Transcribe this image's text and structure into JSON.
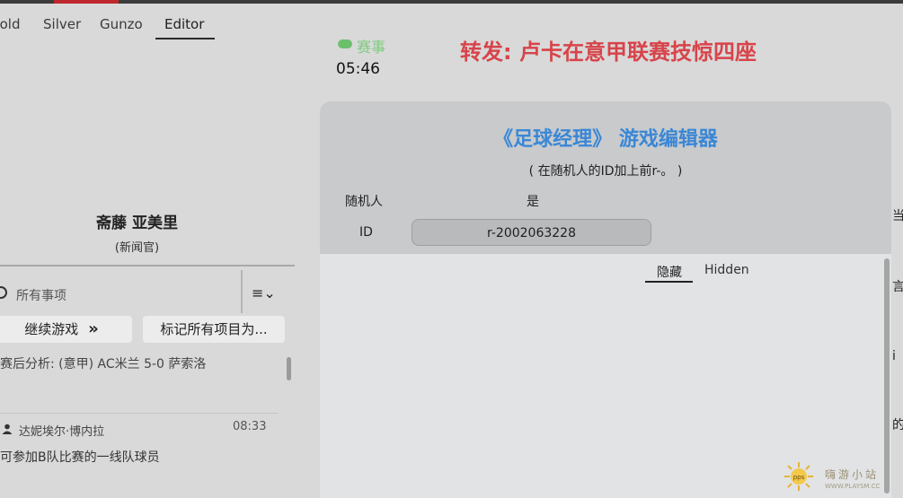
{
  "tabs": [
    {
      "label": "Gold"
    },
    {
      "label": "Silver"
    },
    {
      "label": "Gunzo"
    },
    {
      "label": "Editor"
    }
  ],
  "profile": {
    "name": "斋藤 亚美里",
    "role": "(新闻官)"
  },
  "filter": {
    "placeholder": "所有事项",
    "menu_icon": "≡⌄"
  },
  "actions": {
    "continue_label": "继续游戏",
    "continue_icon": "»",
    "mark_all_label": "标记所有项目为..."
  },
  "news": [
    {
      "subject": "赛后分析: (意甲) AC米兰 5-0 萨索洛"
    },
    {
      "author": "达妮埃尔·博内拉",
      "time": "08:33",
      "subject": "可参加B队比赛的一线队球员"
    }
  ],
  "header": {
    "event_label": "赛事",
    "time": "05:46",
    "headline": "转发:   卢卡在意甲联赛技惊四座"
  },
  "editor": {
    "title": "《足球经理》 游戏编辑器",
    "hint": "( 在随机人的ID加上前r-。 )",
    "random_label": "随机人",
    "random_value": "是",
    "id_label": "ID",
    "id_value": "r-2002063228",
    "tab_hidden_cn": "隐藏",
    "tab_hidden_en": "Hidden"
  },
  "edge_text": [
    "当",
    "言",
    "i",
    "的"
  ],
  "watermark": {
    "text": "嗨游小站",
    "url": "WWW.PLAYSM.CC",
    "badge": "pps"
  },
  "colors": {
    "headline": "#d7444a",
    "editor_title": "#3a87d6",
    "event": "#7ecb7e",
    "accent_bar": "#c0272d"
  }
}
